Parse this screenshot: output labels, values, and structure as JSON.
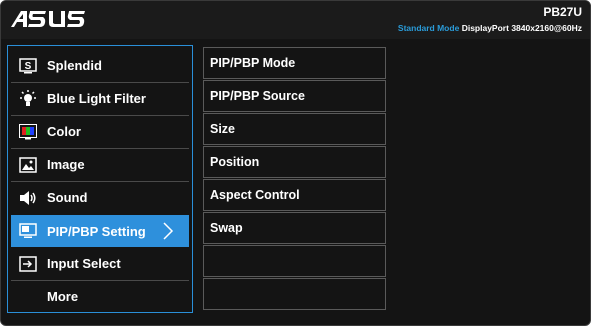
{
  "header": {
    "brand": "ASUS",
    "model": "PB27U",
    "mode": "Standard Mode",
    "port": "DisplayPort",
    "resolution": "3840x2160@60Hz"
  },
  "menu": {
    "items": [
      {
        "label": "Splendid",
        "icon": "splendid-s-icon"
      },
      {
        "label": "Blue Light Filter",
        "icon": "blue-light-bulb-icon"
      },
      {
        "label": "Color",
        "icon": "color-icon"
      },
      {
        "label": "Image",
        "icon": "image-icon"
      },
      {
        "label": "Sound",
        "icon": "speaker-icon"
      },
      {
        "label": "PIP/PBP Setting",
        "icon": "pip-monitor-icon",
        "selected": true
      },
      {
        "label": "Input Select",
        "icon": "input-select-icon"
      },
      {
        "label": "More",
        "icon": ""
      }
    ]
  },
  "submenu": {
    "items": [
      {
        "label": "PIP/PBP Mode"
      },
      {
        "label": "PIP/PBP Source"
      },
      {
        "label": "Size"
      },
      {
        "label": "Position"
      },
      {
        "label": "Aspect Control"
      },
      {
        "label": "Swap"
      },
      {
        "label": ""
      },
      {
        "label": ""
      }
    ]
  },
  "colors": {
    "accent": "#2e90dc",
    "status_mode": "#2a9bd8",
    "background": "#141414"
  }
}
